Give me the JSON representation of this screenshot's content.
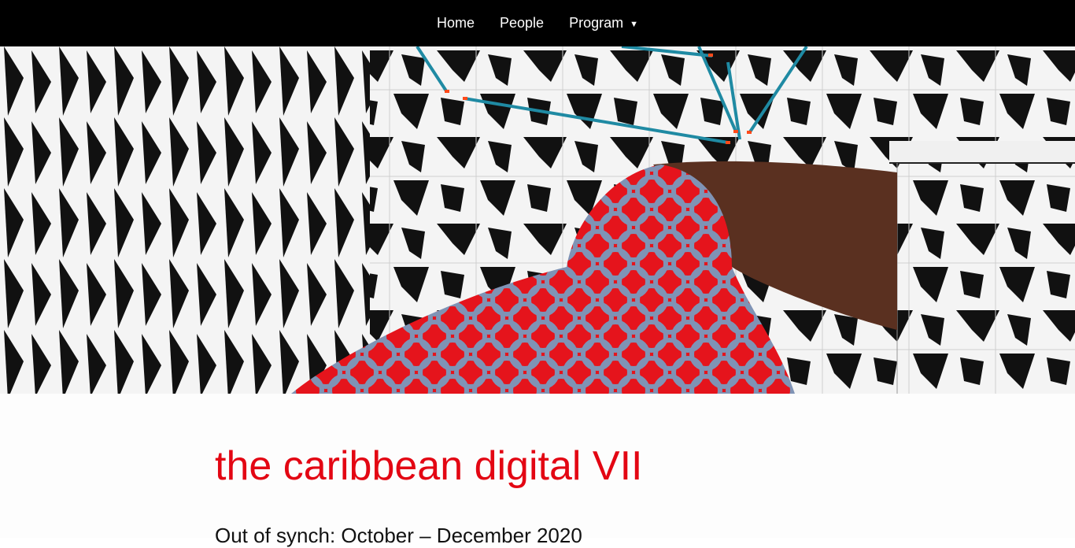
{
  "nav": {
    "items": [
      {
        "label": "Home"
      },
      {
        "label": "People"
      },
      {
        "label": "Program",
        "caret": "▼"
      }
    ]
  },
  "hero": {
    "image": "hero-artwork-photo",
    "colors": {
      "pattern_dark": "#111111",
      "pattern_light": "#f4f4f4",
      "garment_red": "#e5141c",
      "garment_blue": "#7f93b5",
      "skin": "#5a3020",
      "wire": "#1f8aa3"
    }
  },
  "page": {
    "title": "the caribbean digital VII",
    "subtitle": "Out of synch: October – December 2020"
  },
  "colors": {
    "nav_background": "#000000",
    "nav_text": "#ffffff",
    "title": "#e30613"
  }
}
